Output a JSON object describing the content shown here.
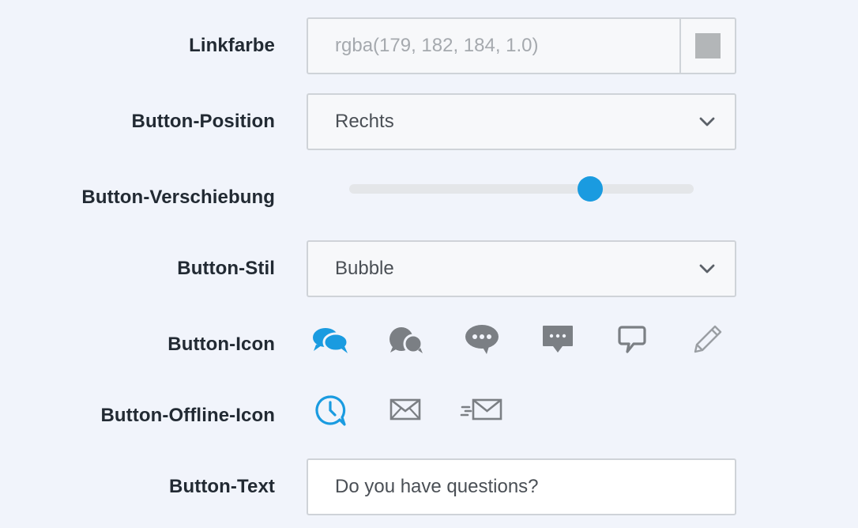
{
  "labels": {
    "link_color": "Linkfarbe",
    "button_position": "Button-Position",
    "button_offset": "Button-Verschiebung",
    "button_style": "Button-Stil",
    "button_icon": "Button-Icon",
    "button_offline_icon": "Button-Offline-Icon",
    "button_text": "Button-Text"
  },
  "link_color": {
    "placeholder": "rgba(179, 182, 184, 1.0)",
    "swatch_color": "#b3b6b8"
  },
  "button_position": {
    "selected": "Rechts"
  },
  "button_offset": {
    "value_fraction": 0.7
  },
  "button_style": {
    "selected": "Bubble"
  },
  "button_icons": [
    {
      "name": "double-bubble-filled",
      "selected": true
    },
    {
      "name": "double-bubble-gray",
      "selected": false
    },
    {
      "name": "speech-bubble-dots",
      "selected": false
    },
    {
      "name": "square-bubble-dots",
      "selected": false
    },
    {
      "name": "square-bubble-outline",
      "selected": false
    },
    {
      "name": "pencil",
      "selected": false
    }
  ],
  "button_offline_icons": [
    {
      "name": "clock-bubble",
      "selected": true
    },
    {
      "name": "envelope",
      "selected": false
    },
    {
      "name": "envelope-fast",
      "selected": false
    }
  ],
  "button_text": {
    "value": "Do you have questions?"
  },
  "colors": {
    "accent": "#1a9be0",
    "icon_gray": "#7b7f84",
    "background": "#f1f4fb"
  }
}
